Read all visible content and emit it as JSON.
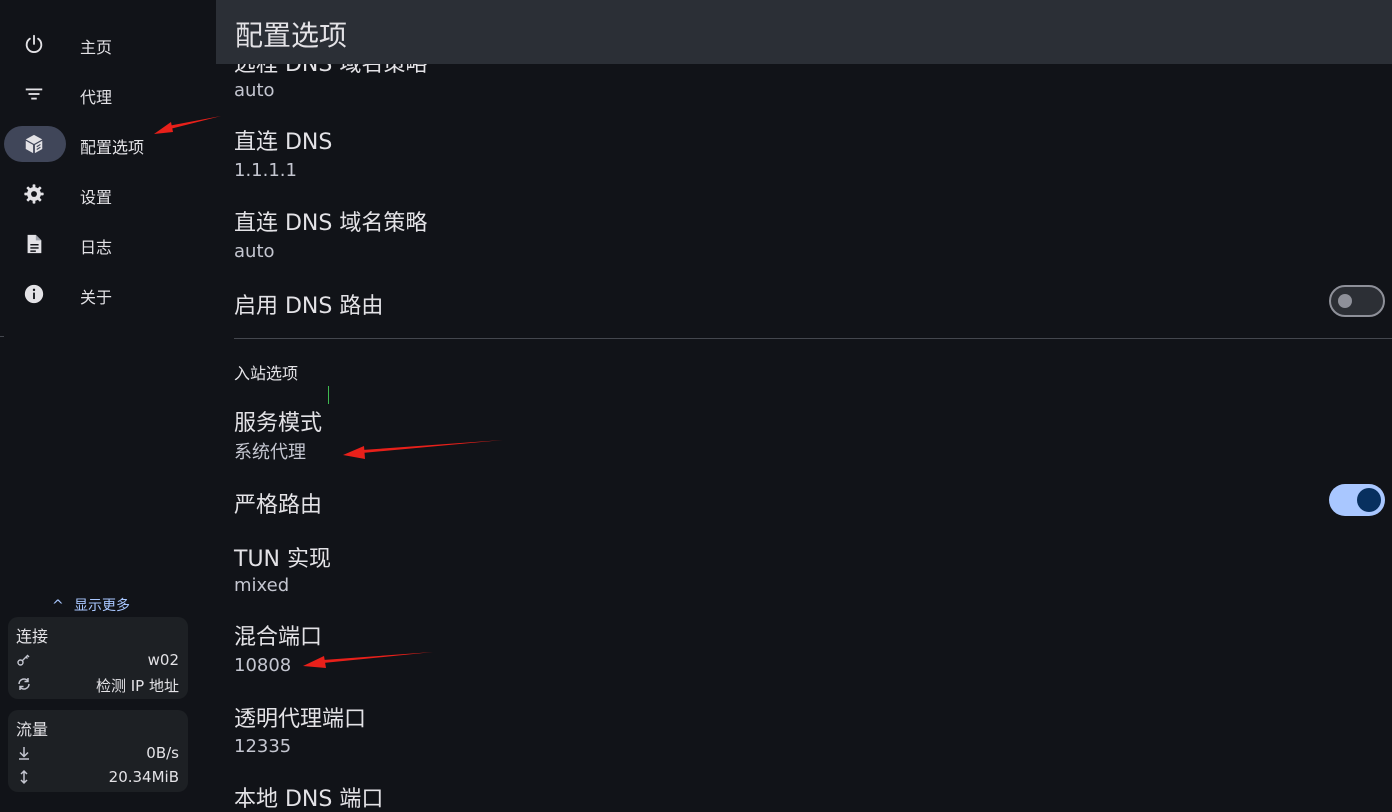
{
  "sidebar": {
    "items": [
      {
        "label": "主页",
        "icon": "power-icon"
      },
      {
        "label": "代理",
        "icon": "filter-list-icon"
      },
      {
        "label": "配置选项",
        "icon": "cube-icon",
        "active": true
      },
      {
        "label": "设置",
        "icon": "gear-icon"
      },
      {
        "label": "日志",
        "icon": "document-icon"
      },
      {
        "label": "关于",
        "icon": "info-icon"
      }
    ],
    "show_more": "显示更多",
    "connection": {
      "title": "连接",
      "profile_value": "w02",
      "ip_label": "检测 IP 地址"
    },
    "traffic": {
      "title": "流量",
      "speed_value": "0B/s",
      "total_value": "20.34MiB"
    }
  },
  "appbar": {
    "title": "配置选项"
  },
  "settings": {
    "partial_top": {
      "title": "远程 DNS 域名策略",
      "value": "auto"
    },
    "direct_dns": {
      "title": "直连 DNS",
      "value": "1.1.1.1"
    },
    "direct_dns_strategy": {
      "title": "直连 DNS 域名策略",
      "value": "auto"
    },
    "enable_dns_routing": {
      "title": "启用 DNS 路由",
      "enabled": false
    },
    "inbound_section": "入站选项",
    "service_mode": {
      "title": "服务模式",
      "value": "系统代理"
    },
    "strict_route": {
      "title": "严格路由",
      "enabled": true
    },
    "tun_impl": {
      "title": "TUN 实现",
      "value": "mixed"
    },
    "mixed_port": {
      "title": "混合端口",
      "value": "10808"
    },
    "transparent_proxy_port": {
      "title": "透明代理端口",
      "value": "12335"
    },
    "local_dns_port": {
      "title": "本地 DNS 端口"
    }
  },
  "colors": {
    "background": "#111318",
    "appbar": "#2b2f36",
    "active_pill": "#404659",
    "accent": "#a9c7ff",
    "annotation_arrow": "#e8201a"
  }
}
